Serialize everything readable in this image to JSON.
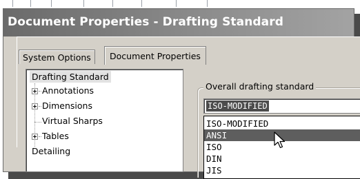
{
  "window": {
    "title": "Document Properties - Drafting Standard"
  },
  "tabs": [
    {
      "label": "System Options",
      "selected": false
    },
    {
      "label": "Document Properties",
      "selected": true
    }
  ],
  "tree": {
    "items": [
      {
        "label": "Drafting Standard",
        "selected": true,
        "level": 0
      },
      {
        "label": "Annotations",
        "expandable": true,
        "level": 1
      },
      {
        "label": "Dimensions",
        "expandable": true,
        "level": 1
      },
      {
        "label": "Virtual Sharps",
        "expandable": false,
        "level": 1
      },
      {
        "label": "Tables",
        "expandable": true,
        "level": 1
      },
      {
        "label": "Detailing",
        "level": 0
      }
    ]
  },
  "drafting": {
    "group_label": "Overall drafting standard",
    "selected_value": "ISO-MODIFIED",
    "options": [
      "ISO-MODIFIED",
      "ANSI",
      "ISO",
      "DIN",
      "JIS"
    ],
    "highlighted_option": "ANSI"
  },
  "colors": {
    "title_bar": "#7a7a7a",
    "dialog_bg": "#d4d0c8",
    "highlight": "#5e5e5e"
  }
}
